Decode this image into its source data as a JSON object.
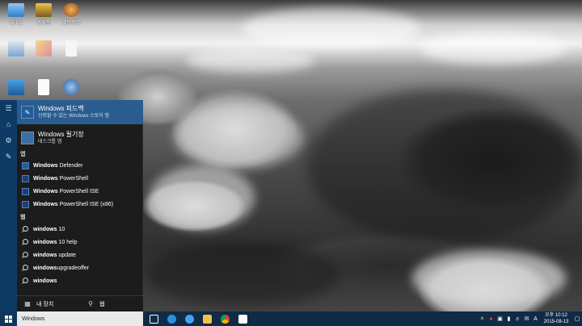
{
  "desktop": {
    "icons": [
      {
        "label": "내 PC",
        "name": "this-pc"
      },
      {
        "label": "휴지통",
        "name": "recycle-bin"
      },
      {
        "label": "네트워크",
        "name": "network"
      },
      {
        "label": "",
        "name": "documents"
      },
      {
        "label": "",
        "name": "image-file"
      },
      {
        "label": "",
        "name": "file-1"
      },
      {
        "label": "",
        "name": "store-app"
      },
      {
        "label": "",
        "name": "file-2"
      },
      {
        "label": "",
        "name": "app-3"
      }
    ]
  },
  "search": {
    "best_match": {
      "title": "Windows 피드백",
      "subtitle": "신뢰할 수 있는 Windows 스토어 앱"
    },
    "second_match": {
      "title": "Windows 될기장",
      "subtitle": "데스크톱 앱"
    },
    "apps_section": "앱",
    "apps": [
      {
        "bold": "Windows",
        "rest": " Defender"
      },
      {
        "bold": "Windows",
        "rest": " PowerShell"
      },
      {
        "bold": "Windows",
        "rest": " PowerShell ISE"
      },
      {
        "bold": "Windows",
        "rest": " PowerShell ISE (x86)"
      }
    ],
    "web_section": "웹",
    "web": [
      {
        "bold": "windows",
        "rest": " 10"
      },
      {
        "bold": "windows",
        "rest": " 10 help"
      },
      {
        "bold": "windows",
        "rest": " update"
      },
      {
        "bold": "windows",
        "rest": "upgradeoffer"
      },
      {
        "bold": "windows",
        "rest": ""
      }
    ],
    "scope": {
      "my_stuff": "내 장치",
      "web": "웹"
    },
    "query": "Windows"
  },
  "taskbar": {
    "apps": [
      "task-view",
      "edge",
      "ie",
      "file-explorer",
      "chrome",
      "store"
    ],
    "clock_time": "오후 10:12",
    "clock_date": "2015-08-13",
    "ime": "A"
  },
  "colors": {
    "accent": "#2a5d8f",
    "taskbar": "#0f2b46",
    "rail": "#0d3b66"
  }
}
